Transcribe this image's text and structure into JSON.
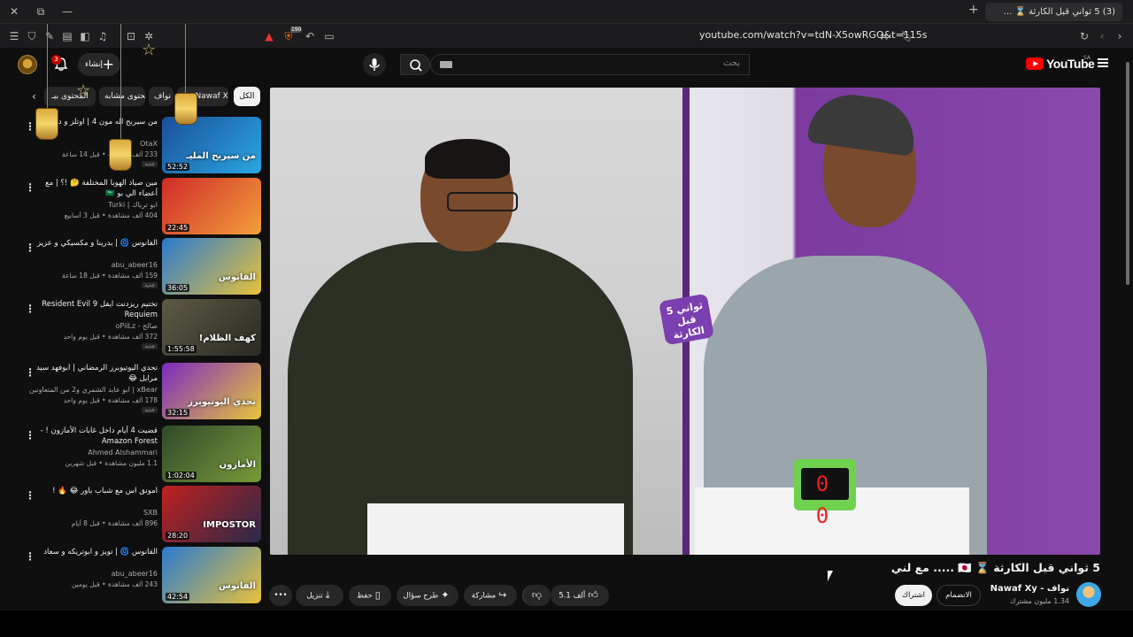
{
  "browser": {
    "url": "youtube.com/watch?v=tdN-X5owRGQ&t=115s",
    "active_tab_title": "(3) 5 ثواني قبل الكارثة ⌛ ...",
    "second_tab_title": "...",
    "badge_count": "190"
  },
  "header": {
    "logo_text": "YouTube",
    "region": "SA",
    "search_placeholder": "بحث",
    "create_label": "إنشاء",
    "notif_count": "3"
  },
  "chips": [
    {
      "label": "الكل",
      "active": true
    },
    {
      "label": "من Nawaf Xy",
      "active": false
    },
    {
      "label": "نواف",
      "active": false
    },
    {
      "label": "محتوى مشابه",
      "active": false
    },
    {
      "label": "المحتوى بيـ",
      "active": false
    }
  ],
  "recommendations": [
    {
      "title": "من سيربح اله مون 4 | اوتلز و دريحة",
      "channel": "OtaX",
      "meta": "233 ألف مشاهدة • قبل 14 ساعة",
      "badge": "جديد",
      "duration": "52:52",
      "thumb_text": "من سيربح المليـ"
    },
    {
      "title": "مين صياد الهوبا المختلفة 🤔 !؟ | مع أعضاء الي بو 🇸🇦",
      "channel": "ابو ترياك | Turki",
      "meta": "404 ألف مشاهدة • قبل 3 أسابيع",
      "badge": "",
      "duration": "22:45",
      "thumb_text": ""
    },
    {
      "title": "الفانوس 🌀 | بدرينا و مكسيكي و عزيز",
      "channel": "abu_abeer16",
      "meta": "159 ألف مشاهدة • قبل 18 ساعة",
      "badge": "جديد",
      "duration": "36:05",
      "thumb_text": "الفانوس"
    },
    {
      "title": "تختيم ريزدنت ايفل 9 Resident Evil Requiem",
      "channel": "صالح - oPiiLz",
      "meta": "372 ألف مشاهدة • قبل يوم واحد",
      "badge": "جديد",
      "duration": "1:55:58",
      "thumb_text": "كهف الظلام!"
    },
    {
      "title": "تحدي اليوتيوبرز الرمضاني | ابوفهد سيد مرايل 😂",
      "channel": "xBear | ابو عابد الشمري و2 من المتعاونين الآخرين",
      "meta": "178 ألف مشاهدة • قبل يوم واحد",
      "badge": "جديد",
      "duration": "32:15",
      "thumb_text": "تحدي اليوتيوبرز"
    },
    {
      "title": "قضيت 4 أيام داخل غابات الأمازون ! - Amazon Forest",
      "channel": "Ahmed Alshammari",
      "meta": "1.1 مليون مشاهدة • قبل شهرين",
      "badge": "",
      "duration": "1:02:04",
      "thumb_text": "الأمازون"
    },
    {
      "title": "امونق اس مع شباب باور 😂 🔥 !",
      "channel": "SXB",
      "meta": "896 ألف مشاهدة • قبل 8 أيام",
      "badge": "",
      "duration": "28:20",
      "thumb_text": "IMPOSTOR"
    },
    {
      "title": "الفانوس 🌀 | تويز و ابوتريكه و سعاد",
      "channel": "abu_abeer16",
      "meta": "243 ألف مشاهدة • قبل يومين",
      "badge": "",
      "duration": "42:54",
      "thumb_text": "الفانوس"
    }
  ],
  "video": {
    "title": "5 ثواني قبل الكارثة ⌛ 🇯🇵 ..... مع لني",
    "timer_digits": "0 0",
    "badge_text": "5 ثواني قبل الكارثة",
    "channel_name": "نواف - Nawaf Xy",
    "subscribers": "1.34 مليون مشترك",
    "join_label": "الانضمام",
    "subscribe_label": "اشتراك",
    "like_count": "5.1 ألف",
    "share_label": "مشاركة",
    "ask_label": "طرح سؤال",
    "save_label": "حفظ",
    "download_label": "تنزيل"
  },
  "colors": {
    "accent": "#ff0000",
    "purple_set": "#7b3fb0",
    "timer_green": "#6fd24f"
  }
}
